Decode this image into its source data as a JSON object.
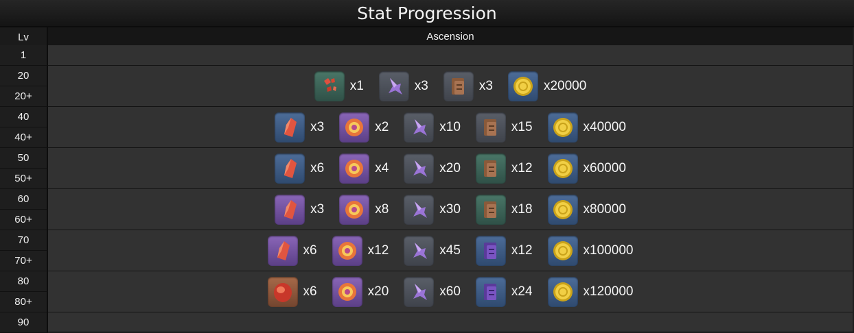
{
  "title": "Stat Progression",
  "header": {
    "lv": "Lv",
    "ascension": "Ascension"
  },
  "levels": [
    "1",
    "20",
    "20+",
    "40",
    "40+",
    "50",
    "50+",
    "60",
    "60+",
    "70",
    "70+",
    "80",
    "80+",
    "90"
  ],
  "rows": [
    {
      "items": [
        {
          "icon": "red-crystal-shards-icon",
          "bg": "teal",
          "qty": "x1"
        },
        {
          "icon": "violet-petal-icon",
          "bg": "gray",
          "qty": "x3"
        },
        {
          "icon": "brown-scroll-icon",
          "bg": "gray",
          "qty": "x3"
        },
        {
          "icon": "gold-coin-icon",
          "bg": "blue",
          "qty": "x20000"
        }
      ]
    },
    {
      "items": [
        {
          "icon": "red-crystal-icon",
          "bg": "blue",
          "qty": "x3"
        },
        {
          "icon": "fire-orb-icon",
          "bg": "purple",
          "qty": "x2"
        },
        {
          "icon": "violet-petal-icon",
          "bg": "gray",
          "qty": "x10"
        },
        {
          "icon": "brown-scroll-icon",
          "bg": "gray",
          "qty": "x15"
        },
        {
          "icon": "gold-coin-icon",
          "bg": "blue",
          "qty": "x40000"
        }
      ]
    },
    {
      "items": [
        {
          "icon": "red-crystal-icon",
          "bg": "blue",
          "qty": "x6"
        },
        {
          "icon": "fire-orb-icon",
          "bg": "purple",
          "qty": "x4"
        },
        {
          "icon": "violet-petal-icon",
          "bg": "gray",
          "qty": "x20"
        },
        {
          "icon": "brown-scroll-icon",
          "bg": "teal",
          "qty": "x12"
        },
        {
          "icon": "gold-coin-icon",
          "bg": "blue",
          "qty": "x60000"
        }
      ]
    },
    {
      "items": [
        {
          "icon": "red-crystal-icon",
          "bg": "purple",
          "qty": "x3"
        },
        {
          "icon": "fire-orb-icon",
          "bg": "purple",
          "qty": "x8"
        },
        {
          "icon": "violet-petal-icon",
          "bg": "gray",
          "qty": "x30"
        },
        {
          "icon": "brown-scroll-icon",
          "bg": "teal",
          "qty": "x18"
        },
        {
          "icon": "gold-coin-icon",
          "bg": "blue",
          "qty": "x80000"
        }
      ]
    },
    {
      "items": [
        {
          "icon": "red-crystal-icon",
          "bg": "purple",
          "qty": "x6"
        },
        {
          "icon": "fire-orb-icon",
          "bg": "purple",
          "qty": "x12"
        },
        {
          "icon": "violet-petal-icon",
          "bg": "gray",
          "qty": "x45"
        },
        {
          "icon": "purple-scroll-icon",
          "bg": "blue",
          "qty": "x12"
        },
        {
          "icon": "gold-coin-icon",
          "bg": "blue",
          "qty": "x100000"
        }
      ]
    },
    {
      "items": [
        {
          "icon": "red-gem-icon",
          "bg": "bronze",
          "qty": "x6"
        },
        {
          "icon": "fire-orb-icon",
          "bg": "purple",
          "qty": "x20"
        },
        {
          "icon": "violet-petal-icon",
          "bg": "gray",
          "qty": "x60"
        },
        {
          "icon": "purple-scroll-icon",
          "bg": "blue",
          "qty": "x24"
        },
        {
          "icon": "gold-coin-icon",
          "bg": "blue",
          "qty": "x120000"
        }
      ]
    }
  ]
}
